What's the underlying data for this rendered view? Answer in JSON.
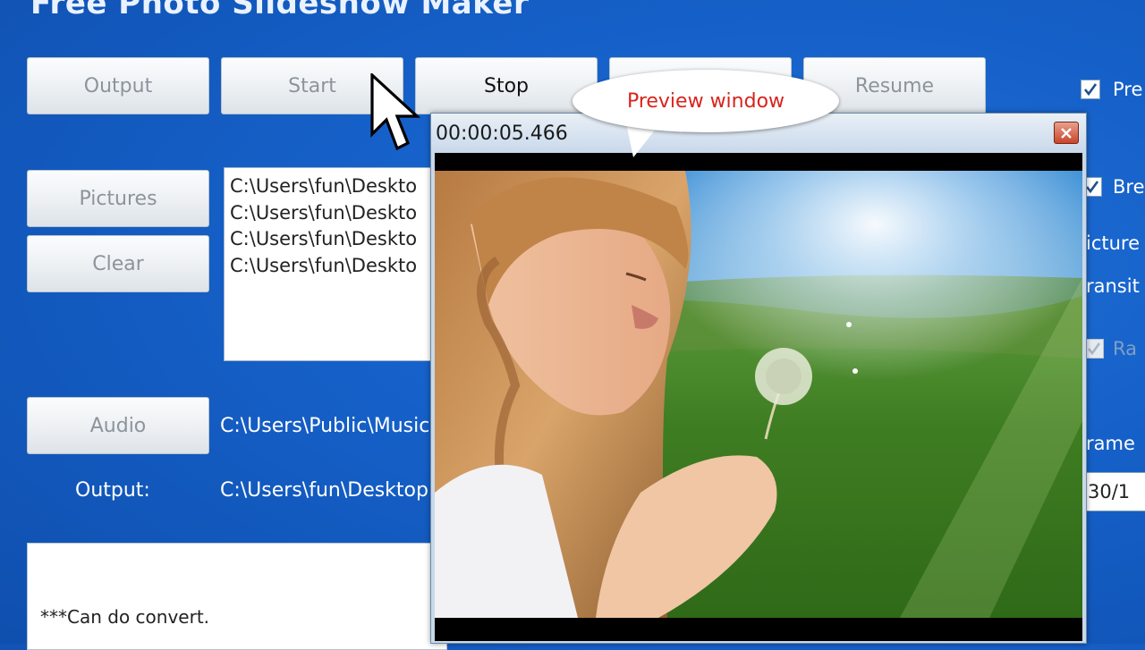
{
  "app": {
    "title": "Free Photo Slideshow Maker"
  },
  "buttons": {
    "output": "Output",
    "start": "Start",
    "stop": "Stop",
    "pause": "",
    "resume": "Resume",
    "pictures": "Pictures",
    "clear": "Clear",
    "audio": "Audio"
  },
  "picture_list": [
    "C:\\Users\\fun\\Deskto",
    "C:\\Users\\fun\\Deskto",
    "C:\\Users\\fun\\Deskto",
    "C:\\Users\\fun\\Deskto"
  ],
  "audio_path": "C:\\Users\\Public\\Music",
  "output_label": "Output:",
  "output_path": "C:\\Users\\fun\\Desktop",
  "log_text": "***Can do convert.",
  "right_panel": {
    "check1_label": "Pre",
    "check2_label": "Bre",
    "pictures_label": "icture",
    "transition_label": "ransit",
    "check3_label": "Ra",
    "frame_label": "rame",
    "frame_rate_value": "30/1"
  },
  "preview": {
    "time": "00:00:05.466",
    "callout": "Preview window"
  },
  "colors": {
    "background": "#1560c8",
    "callout_text": "#d8241c"
  }
}
